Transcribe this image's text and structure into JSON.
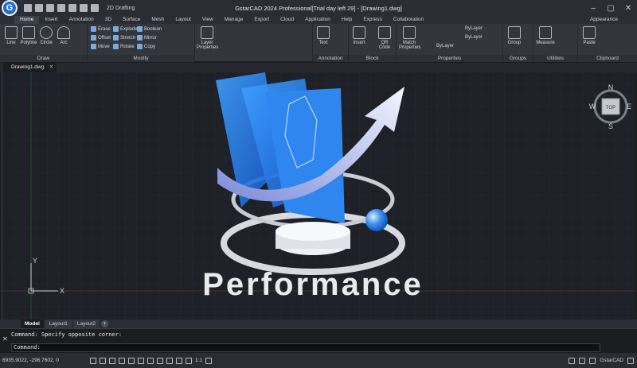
{
  "titlebar": {
    "title": "GstarCAD 2024 Professional[Trial day left 29] - [Drawing1.dwg]",
    "workspace": "2D Drafting",
    "logo_letter": "G"
  },
  "ribbon_tabs": [
    "Home",
    "Insert",
    "Annotation",
    "3D",
    "Surface",
    "Mesh",
    "Layout",
    "View",
    "Manage",
    "Export",
    "Cloud",
    "Application",
    "Help",
    "Express",
    "Collaboration"
  ],
  "appearance_label": "Appearance",
  "panels": {
    "draw": {
      "title": "Draw",
      "line": "Line",
      "polyline": "Polyline",
      "circle": "Circle",
      "arc": "Arc"
    },
    "modify": {
      "title": "Modify",
      "erase": "Erase",
      "explode": "Explode",
      "boolean": "Boolean",
      "offset": "Offset",
      "stretch": "Stretch",
      "mirror": "Mirror",
      "move": "Move",
      "rotate": "Rotate",
      "copy": "Copy"
    },
    "layers": {
      "layer_props": "Layer Properties"
    },
    "annotation": {
      "title": "Annotation",
      "text": "Text"
    },
    "block": {
      "title": "Block",
      "insert": "Insert",
      "qr": "QR Code"
    },
    "properties": {
      "title": "Properties",
      "match": "Match Properties",
      "bylayer1": "ByLayer",
      "bylayer2": "ByLayer",
      "bylayer3": "ByLayer"
    },
    "groups": {
      "title": "Groups",
      "group": "Group"
    },
    "utilities": {
      "title": "Utilities",
      "measure": "Measure"
    },
    "clipboard": {
      "title": "Clipboard",
      "paste": "Paste"
    }
  },
  "doc_tab": "Drawing1.dwg",
  "canvas": {
    "performance_text": "Performance",
    "viewcube_top": "TOP",
    "compass": {
      "n": "N",
      "s": "S",
      "e": "E",
      "w": "W"
    },
    "ucs_x": "X",
    "ucs_y": "Y"
  },
  "layout_tabs": [
    "Model",
    "Layout1",
    "Layout2"
  ],
  "command": {
    "history": "Command: Specify opposite corner:",
    "prompt": "Command:"
  },
  "status": {
    "coords": "6935.9022, -296.7602, 0",
    "app_name": "GstarCAD",
    "scale": "1:1"
  }
}
